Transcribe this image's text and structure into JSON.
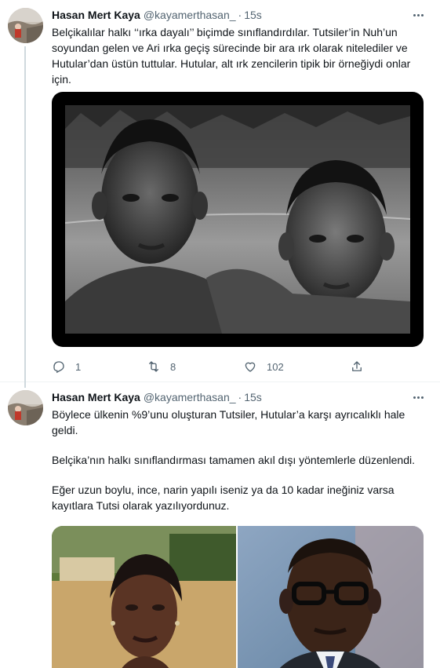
{
  "tweets": [
    {
      "author_name": "Hasan Mert Kaya",
      "handle": "@kayamerthasan_",
      "separator": "·",
      "time": "15s",
      "text_lines": [
        "Belçikalılar halkı ‘‘ırka dayalı’’ biçimde sınıflandırdılar. Tutsiler’in Nuh’un",
        "soyundan gelen ve Ari ırka geçiş sürecinde bir ara ırk olarak nitelediler ve",
        "Hutular’dan üstün tuttular. Hutular, alt ırk zencilerin tipik bir örneğiydi onlar",
        "için."
      ],
      "media_icon": "black-and-white-photo-two-boys",
      "actions": {
        "reply": {
          "icon": "reply-icon",
          "count": "1"
        },
        "retweet": {
          "icon": "retweet-icon",
          "count": "8"
        },
        "like": {
          "icon": "heart-icon",
          "count": "102"
        },
        "share": {
          "icon": "share-icon"
        }
      }
    },
    {
      "author_name": "Hasan Mert Kaya",
      "handle": "@kayamerthasan_",
      "separator": "·",
      "time": "15s",
      "paragraphs": [
        [
          "Böylece ülkenin %9’unu oluşturan Tutsiler, Hutular’a karşı ayrıcalıklı hale",
          "geldi."
        ],
        [
          "Belçika’nın halkı sınıflandırması tamamen akıl dışı yöntemlerle düzenlendi."
        ],
        [
          "Eğer uzun boylu, ince, narin yapılı iseniz ya da 10 kadar ineğiniz varsa",
          "kayıtlara Tutsi olarak yazılıyordunuz."
        ]
      ],
      "media_icons": [
        "photo-woman-portrait",
        "photo-man-with-glasses"
      ]
    }
  ],
  "colors": {
    "text": "#0f1419",
    "secondary": "#536471",
    "divider": "#eff3f4",
    "thread_line": "#cfd9de"
  }
}
